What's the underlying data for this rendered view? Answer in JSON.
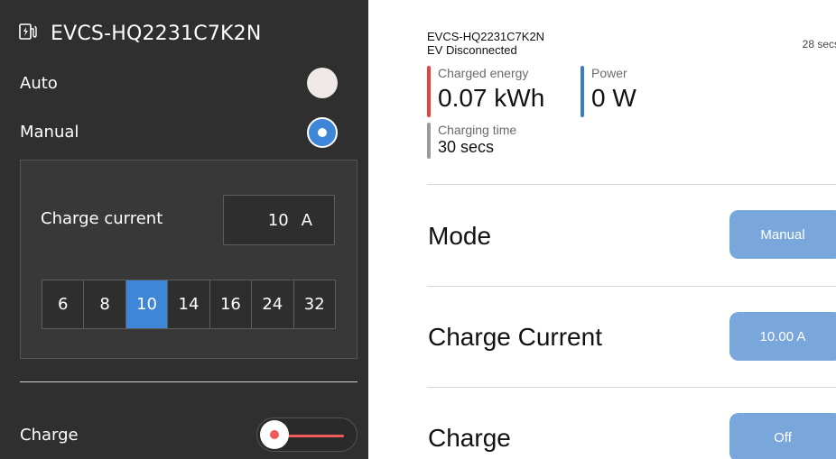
{
  "left_panel": {
    "title": "EVCS-HQ2231C7K2N",
    "title_icon": "ev-charger-icon",
    "auto_label": "Auto",
    "manual_label": "Manual",
    "mode_selected": "Manual",
    "charge_current": {
      "label": "Charge current",
      "value": "10",
      "unit": "A",
      "options": [
        "6",
        "8",
        "10",
        "14",
        "16",
        "24",
        "32"
      ],
      "selected": "10"
    },
    "charge_label": "Charge",
    "charge_switch_on": false
  },
  "right_panel": {
    "device_name": "EVCS-HQ2231C7K2N",
    "status": "EV Disconnected",
    "elapsed": "28 secs",
    "metrics": {
      "charged_energy": {
        "label": "Charged energy",
        "value": "0.07 kWh",
        "color": "#e8423a"
      },
      "power": {
        "label": "Power",
        "value": "0 W",
        "color": "#3d7cc9"
      },
      "charging_time": {
        "label": "Charging time",
        "value": "30 secs",
        "color": "#9a9a9a"
      }
    },
    "rows": {
      "mode": {
        "label": "Mode",
        "value": "Manual"
      },
      "charge_current": {
        "label": "Charge Current",
        "value": "10.00 A"
      },
      "charge": {
        "label": "Charge",
        "value": "Off"
      }
    },
    "accent_color": "#79a7dc"
  }
}
